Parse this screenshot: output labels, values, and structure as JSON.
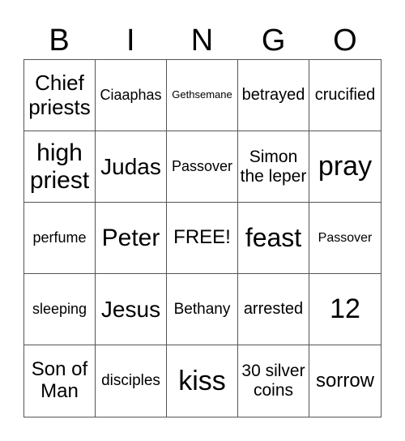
{
  "header": [
    "B",
    "I",
    "N",
    "G",
    "O"
  ],
  "cells": [
    {
      "text": "Chief priests",
      "size": 26
    },
    {
      "text": "Ciaaphas",
      "size": 18
    },
    {
      "text": "Gethsemane",
      "size": 13
    },
    {
      "text": "betrayed",
      "size": 20
    },
    {
      "text": "crucified",
      "size": 20
    },
    {
      "text": "high priest",
      "size": 30
    },
    {
      "text": "Judas",
      "size": 28
    },
    {
      "text": "Passover",
      "size": 18
    },
    {
      "text": "Simon the leper",
      "size": 21
    },
    {
      "text": "pray",
      "size": 34
    },
    {
      "text": "perfume",
      "size": 18
    },
    {
      "text": "Peter",
      "size": 30
    },
    {
      "text": "FREE!",
      "size": 24
    },
    {
      "text": "feast",
      "size": 32
    },
    {
      "text": "Passover",
      "size": 16
    },
    {
      "text": "sleeping",
      "size": 18
    },
    {
      "text": "Jesus",
      "size": 28
    },
    {
      "text": "Bethany",
      "size": 19
    },
    {
      "text": "arrested",
      "size": 20
    },
    {
      "text": "12",
      "size": 34
    },
    {
      "text": "Son of Man",
      "size": 24
    },
    {
      "text": "disciples",
      "size": 19
    },
    {
      "text": "kiss",
      "size": 34
    },
    {
      "text": "30 silver coins",
      "size": 21
    },
    {
      "text": "sorrow",
      "size": 24
    }
  ]
}
